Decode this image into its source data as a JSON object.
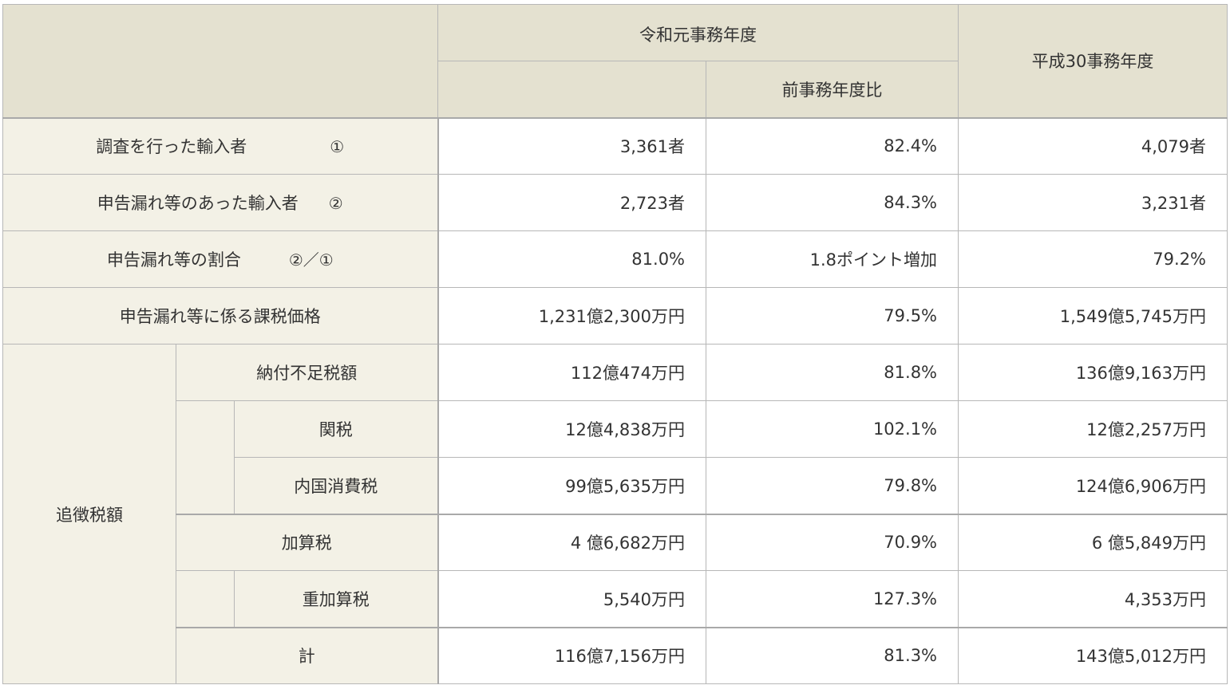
{
  "header": {
    "current_year": "令和元事務年度",
    "ratio": "前事務年度比",
    "prev_year": "平成30事務年度"
  },
  "rows": [
    {
      "label": "調査を行った輸入者",
      "mark": "①",
      "current": "3,361者",
      "ratio": "82.4%",
      "prev": "4,079者"
    },
    {
      "label": "申告漏れ等のあった輸入者",
      "mark": "②",
      "current": "2,723者",
      "ratio": "84.3%",
      "prev": "3,231者"
    },
    {
      "label": "申告漏れ等の割合",
      "mark": "②／①",
      "current": "81.0%",
      "ratio": "1.8ポイント増加",
      "prev": "79.2%"
    },
    {
      "label": "申告漏れ等に係る課税価格",
      "current": "1,231億2,300万円",
      "ratio": "79.5%",
      "prev": "1,549億5,745万円"
    }
  ],
  "penalty": {
    "group_label": "追徴税額",
    "rows": [
      {
        "label": "納付不足税額",
        "current": "112億474万円",
        "ratio": "81.8%",
        "prev": "136億9,163万円"
      },
      {
        "label": "関税",
        "current": "12億4,838万円",
        "ratio": "102.1%",
        "prev": "12億2,257万円"
      },
      {
        "label": "内国消費税",
        "current": "99億5,635万円",
        "ratio": "79.8%",
        "prev": "124億6,906万円"
      },
      {
        "label": "加算税",
        "current": "4 億6,682万円",
        "ratio": "70.9%",
        "prev": "6 億5,849万円"
      },
      {
        "label": "重加算税",
        "current": "5,540万円",
        "ratio": "127.3%",
        "prev": "4,353万円"
      },
      {
        "label": "計",
        "current": "116億7,156万円",
        "ratio": "81.3%",
        "prev": "143億5,012万円"
      }
    ]
  }
}
